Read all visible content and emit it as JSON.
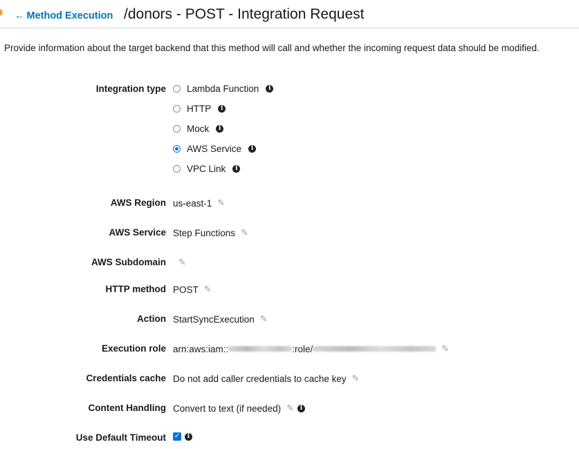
{
  "header": {
    "back_label": "Method Execution",
    "title": "/donors - POST - Integration Request"
  },
  "description": "Provide information about the target backend that this method will call and whether the incoming request data should be modified.",
  "integration_type": {
    "label": "Integration type",
    "options": [
      {
        "label": "Lambda Function",
        "selected": false
      },
      {
        "label": "HTTP",
        "selected": false
      },
      {
        "label": "Mock",
        "selected": false
      },
      {
        "label": "AWS Service",
        "selected": true
      },
      {
        "label": "VPC Link",
        "selected": false
      }
    ]
  },
  "fields": {
    "region": {
      "label": "AWS Region",
      "value": "us-east-1"
    },
    "service": {
      "label": "AWS Service",
      "value": "Step Functions"
    },
    "subdomain": {
      "label": "AWS Subdomain",
      "value": ""
    },
    "http_method": {
      "label": "HTTP method",
      "value": "POST"
    },
    "action": {
      "label": "Action",
      "value": "StartSyncExecution"
    },
    "execution_role": {
      "label": "Execution role",
      "prefix": "arn:aws:iam::",
      "middle": ":role/"
    },
    "credentials_cache": {
      "label": "Credentials cache",
      "value": "Do not add caller credentials to cache key"
    },
    "content_handling": {
      "label": "Content Handling",
      "value": "Convert to text (if needed)"
    },
    "default_timeout": {
      "label": "Use Default Timeout",
      "checked": true
    }
  },
  "colors": {
    "link": "#0073bb",
    "radio_selected": "#0a72d8",
    "indicator_dot": "#f0a53a"
  }
}
